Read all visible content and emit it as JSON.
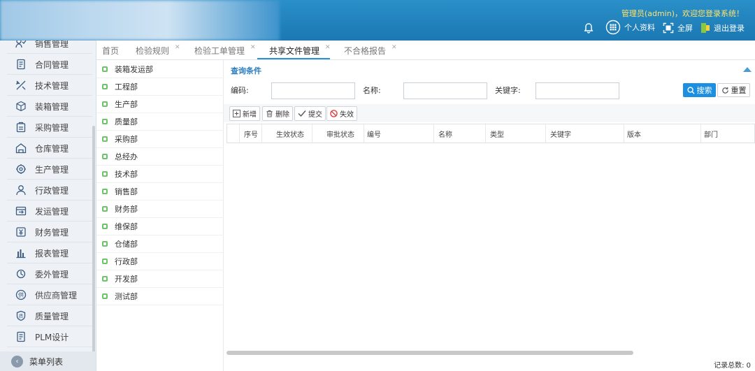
{
  "header": {
    "welcome": "管理员(admin)，欢迎您登录系统！",
    "profile_label": "个人资料",
    "fullscreen_label": "全屏",
    "logout_label": "退出登录"
  },
  "sidebar": {
    "items": [
      {
        "label": "销售管理",
        "icon": "sales-icon"
      },
      {
        "label": "合同管理",
        "icon": "contract-icon"
      },
      {
        "label": "技术管理",
        "icon": "tech-icon"
      },
      {
        "label": "装箱管理",
        "icon": "box-icon"
      },
      {
        "label": "采购管理",
        "icon": "purchase-icon"
      },
      {
        "label": "仓库管理",
        "icon": "warehouse-icon"
      },
      {
        "label": "生产管理",
        "icon": "production-icon"
      },
      {
        "label": "行政管理",
        "icon": "admin-icon"
      },
      {
        "label": "发运管理",
        "icon": "shipping-icon"
      },
      {
        "label": "财务管理",
        "icon": "finance-icon"
      },
      {
        "label": "报表管理",
        "icon": "report-icon"
      },
      {
        "label": "委外管理",
        "icon": "outsource-icon"
      },
      {
        "label": "供应商管理",
        "icon": "supplier-icon"
      },
      {
        "label": "质量管理",
        "icon": "quality-icon"
      },
      {
        "label": "PLM设计",
        "icon": "plm-icon"
      }
    ],
    "menu_list_label": "菜单列表"
  },
  "tabs": [
    {
      "label": "首页",
      "closable": false
    },
    {
      "label": "检验规则",
      "closable": true
    },
    {
      "label": "检验工单管理",
      "closable": true
    },
    {
      "label": "共享文件管理",
      "closable": true,
      "active": true
    },
    {
      "label": "不合格报告",
      "closable": true
    }
  ],
  "tree": {
    "items": [
      "装箱发运部",
      "工程部",
      "生产部",
      "质量部",
      "采购部",
      "总经办",
      "技术部",
      "销售部",
      "财务部",
      "维保部",
      "仓储部",
      "行政部",
      "开发部",
      "测试部"
    ]
  },
  "query": {
    "title": "查询条件",
    "code_label": "编码:",
    "code_value": "",
    "name_label": "名称:",
    "name_value": "",
    "keyword_label": "关键字:",
    "keyword_value": "",
    "search_label": "搜索",
    "reset_label": "重置"
  },
  "toolbar": {
    "add_label": "新增",
    "delete_label": "删除",
    "submit_label": "提交",
    "invalidate_label": "失效"
  },
  "grid": {
    "columns": [
      "序号",
      "生效状态",
      "审批状态",
      "编号",
      "名称",
      "类型",
      "关键字",
      "版本",
      "部门"
    ],
    "rows": []
  },
  "footer": {
    "record_count_text": "记录总数: 0"
  },
  "colors": {
    "header_bg": "#1b78b3",
    "welcome_text": "#ffe36a",
    "accent": "#1d8fe1",
    "tree_node": "#6cc36c"
  }
}
